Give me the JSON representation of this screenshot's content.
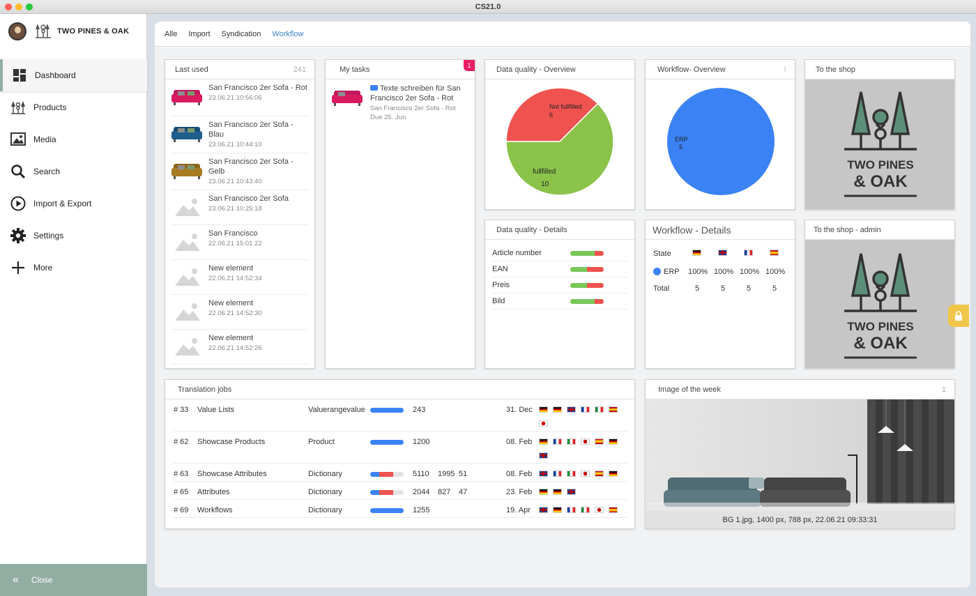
{
  "app": {
    "title": "CS21.0"
  },
  "window_controls": {
    "close": "#fe5f57",
    "minimize": "#febc2e",
    "zoom": "#28c840"
  },
  "brand": {
    "name": "TWO PINES & OAK"
  },
  "sidebar": {
    "items": [
      {
        "label": "Dashboard",
        "icon": "dashboard-icon"
      },
      {
        "label": "Products",
        "icon": "products-icon"
      },
      {
        "label": "Media",
        "icon": "media-icon"
      },
      {
        "label": "Search",
        "icon": "search-icon"
      },
      {
        "label": "Import & Export",
        "icon": "play-circle-icon"
      },
      {
        "label": "Settings",
        "icon": "gear-icon"
      },
      {
        "label": "More",
        "icon": "plus-icon"
      }
    ],
    "close_label": "Close",
    "accent": "#92ada2"
  },
  "tabs": [
    {
      "label": "Alle"
    },
    {
      "label": "Import"
    },
    {
      "label": "Syndication"
    },
    {
      "label": "Workflow"
    }
  ],
  "last_used": {
    "title": "Last used",
    "count": "241",
    "items": [
      {
        "title": "San Francisco 2er Sofa - Rot",
        "date": "23.06.21 10:56:06",
        "thumb": "sofa-red"
      },
      {
        "title": "San Francisco 2er Sofa - Blau",
        "date": "23.06.21 10:44:10",
        "thumb": "sofa-blue"
      },
      {
        "title": "San Francisco 2er Sofa - Gelb",
        "date": "23.06.21 10:43:40",
        "thumb": "sofa-yellow"
      },
      {
        "title": "San Francisco 2er Sofa",
        "date": "23.06.21 10:25:18",
        "thumb": "placeholder"
      },
      {
        "title": "San Francisco",
        "date": "22.06.21 15:01:22",
        "thumb": "placeholder"
      },
      {
        "title": "New element",
        "date": "22.06.21 14:52:34",
        "thumb": "placeholder"
      },
      {
        "title": "New element",
        "date": "22.06.21 14:52:30",
        "thumb": "placeholder"
      },
      {
        "title": "New element",
        "date": "22.06.21 14:52:26",
        "thumb": "placeholder"
      }
    ]
  },
  "my_tasks": {
    "title": "My tasks",
    "badge": "1",
    "task": {
      "title": "Texte schreiben für San Francisco 2er Sofa - Rot",
      "subtitle": "San Francisco 2er Sofa - Rot",
      "due": "Due 25. Jun"
    }
  },
  "dq_overview": {
    "title": "Data quality - Overview",
    "menu": "⁝"
  },
  "wf_overview": {
    "title": "Workflow- Overview",
    "menu": "⁝"
  },
  "to_shop": {
    "title": "To the shop",
    "logo_line1": "TWO PINES",
    "logo_line2": "& OAK"
  },
  "to_shop_admin": {
    "title": "To the shop - admin",
    "logo_line1": "TWO PINES",
    "logo_line2": "& OAK"
  },
  "dq_details": {
    "title": "Data quality - Details",
    "rows": [
      {
        "label": "Article number",
        "fill": 0.72
      },
      {
        "label": "EAN",
        "fill": 0.5
      },
      {
        "label": "Preis",
        "fill": 0.5
      },
      {
        "label": "Bild",
        "fill": 0.72
      }
    ]
  },
  "wf_details": {
    "title": "Workflow - Details",
    "state_label": "State",
    "flags": [
      "de",
      "uk",
      "fr",
      "es"
    ],
    "erp_label": "ERP",
    "erp_values": [
      "100%",
      "100%",
      "100%",
      "100%"
    ],
    "total_label": "Total",
    "total_values": [
      "5",
      "5",
      "5",
      "5"
    ]
  },
  "translation_jobs": {
    "title": "Translation jobs",
    "rows": [
      {
        "id": "# 33",
        "name": "Value Lists",
        "type": "Valuerangevalue",
        "n1": "243",
        "n2": "",
        "n3": "",
        "date": "31. Dec",
        "blue": 1.0,
        "red": 0.0,
        "flags": [
          "de",
          "de",
          "uk",
          "fr",
          "it",
          "es",
          "jp"
        ]
      },
      {
        "id": "# 62",
        "name": "Showcase Products",
        "type": "Product",
        "n1": "1200",
        "n2": "",
        "n3": "",
        "date": "08. Feb",
        "blue": 1.0,
        "red": 0.0,
        "flags": [
          "de",
          "fr",
          "it",
          "jp",
          "es",
          "de",
          "uk"
        ]
      },
      {
        "id": "# 63",
        "name": "Showcase Attributes",
        "type": "Dictionary",
        "n1": "5110",
        "n2": "1995",
        "n3": "51",
        "date": "08. Feb",
        "blue": 0.28,
        "red": 0.4,
        "flags": [
          "uk",
          "fr",
          "it",
          "jp",
          "es",
          "de"
        ]
      },
      {
        "id": "# 65",
        "name": "Attributes",
        "type": "Dictionary",
        "n1": "2044",
        "n2": "827",
        "n3": "47",
        "date": "23. Feb",
        "blue": 0.28,
        "red": 0.4,
        "flags": [
          "de",
          "de",
          "uk"
        ]
      },
      {
        "id": "# 69",
        "name": "Workflows",
        "type": "Dictionary",
        "n1": "1255",
        "n2": "",
        "n3": "",
        "date": "19. Apr",
        "blue": 1.0,
        "red": 0.0,
        "flags": [
          "uk",
          "de",
          "fr",
          "it",
          "jp",
          "es"
        ]
      }
    ]
  },
  "image_week": {
    "title": "Image of the week",
    "count": "1",
    "caption": "BG 1.jpg, 1400 px, 788 px, 22.06.21 09:33:31"
  },
  "chart_data": [
    {
      "type": "pie",
      "title": "Data quality - Overview",
      "categories": [
        "Not fullfilled",
        "fullfilled"
      ],
      "values": [
        6,
        10
      ],
      "colors": [
        "#ef5350",
        "#8bc34a"
      ]
    },
    {
      "type": "pie",
      "title": "Workflow- Overview",
      "categories": [
        "ERP"
      ],
      "values": [
        5
      ],
      "colors": [
        "#3b82f6"
      ]
    }
  ]
}
